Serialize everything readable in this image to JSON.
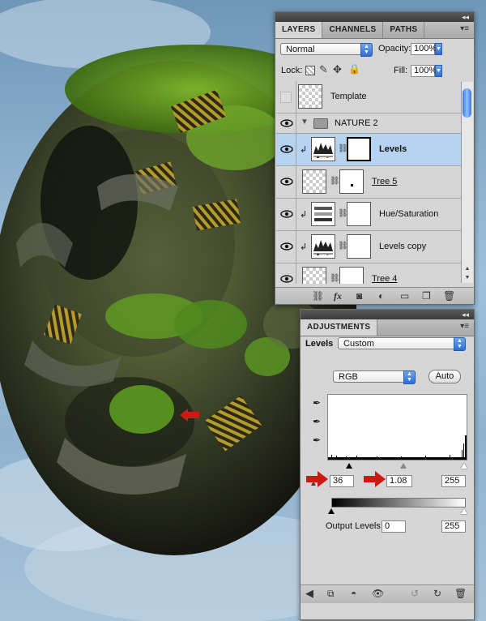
{
  "layers_panel": {
    "tabs": [
      "LAYERS",
      "CHANNELS",
      "PATHS"
    ],
    "blend_mode": "Normal",
    "opacity_label": "Opacity:",
    "opacity_value": "100%",
    "lock_label": "Lock:",
    "fill_label": "Fill:",
    "fill_value": "100%",
    "layers": [
      {
        "name": "Template",
        "visible": false,
        "style": "normal"
      },
      {
        "name": "NATURE 2",
        "visible": true,
        "style": "group"
      },
      {
        "name": "Levels",
        "visible": true,
        "style": "bold",
        "selected": true
      },
      {
        "name": "Tree 5",
        "visible": true,
        "style": "underline"
      },
      {
        "name": "Hue/Saturation",
        "visible": true,
        "style": "normal"
      },
      {
        "name": "Levels copy",
        "visible": true,
        "style": "normal"
      },
      {
        "name": "Tree 4",
        "visible": true,
        "style": "underline"
      }
    ]
  },
  "adjustments_panel": {
    "tab": "ADJUSTMENTS",
    "adjustment_name": "Levels",
    "preset": "Custom",
    "channel": "RGB",
    "auto_label": "Auto",
    "input_black": "36",
    "input_gamma": "1.08",
    "input_white": "255",
    "output_levels_label": "Output Levels:",
    "output_black": "0",
    "output_white": "255"
  },
  "annotations": {
    "arrow_color": "#cc1a12"
  },
  "colors": {
    "selection": "#b7d3f2",
    "accent_blue": "#2a6fd7"
  }
}
